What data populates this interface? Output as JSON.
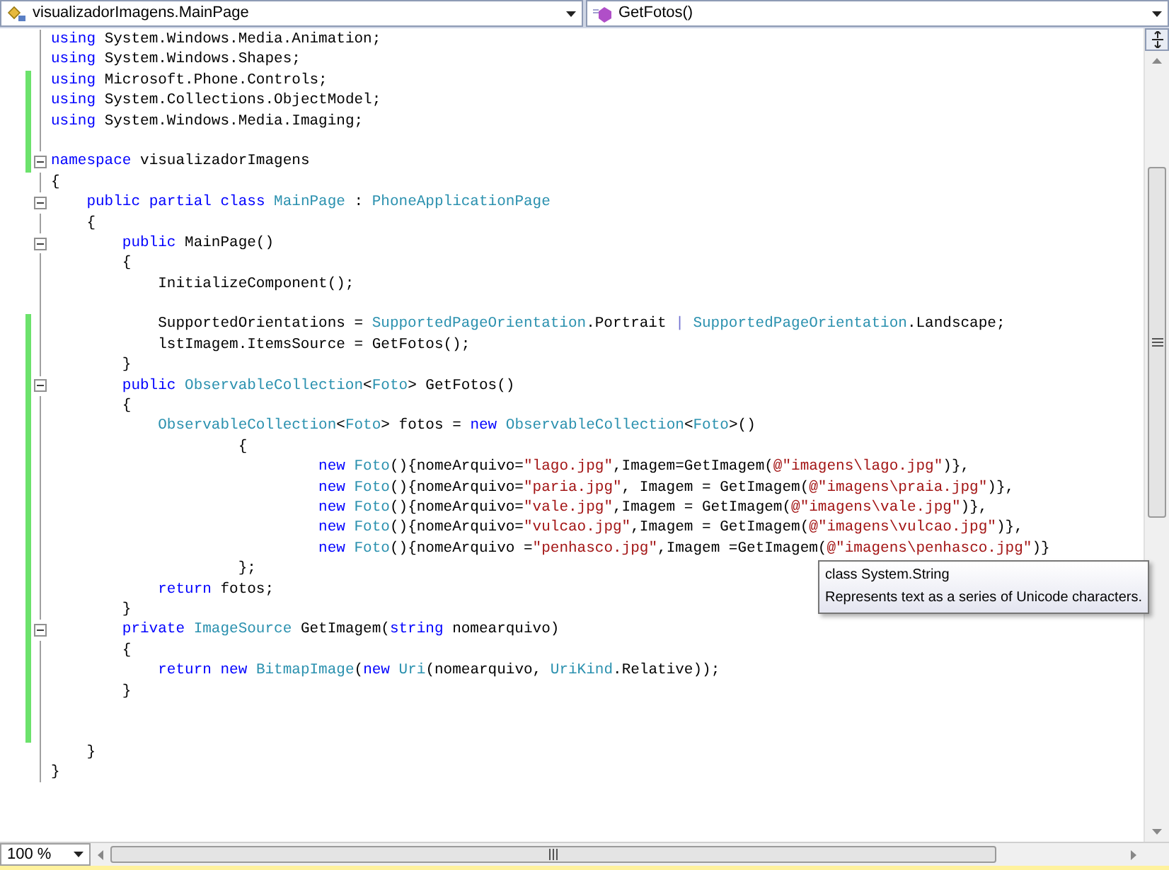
{
  "navigation": {
    "type_combo": "visualizadorImagens.MainPage",
    "member_combo": "GetFotos()"
  },
  "editor": {
    "lines": [
      {
        "changed": false,
        "collapsible": false,
        "segments": [
          {
            "text": "using",
            "kind": "keyword"
          },
          {
            "text": " System.Windows.Media.Animation;",
            "kind": "plain"
          }
        ]
      },
      {
        "changed": false,
        "collapsible": false,
        "segments": [
          {
            "text": "using",
            "kind": "keyword"
          },
          {
            "text": " System.Windows.Shapes;",
            "kind": "plain"
          }
        ]
      },
      {
        "changed": true,
        "collapsible": false,
        "segments": [
          {
            "text": "using",
            "kind": "keyword"
          },
          {
            "text": " Microsoft.Phone.Controls;",
            "kind": "plain"
          }
        ]
      },
      {
        "changed": true,
        "collapsible": false,
        "segments": [
          {
            "text": "using",
            "kind": "keyword"
          },
          {
            "text": " System.Collections.ObjectModel;",
            "kind": "plain"
          }
        ]
      },
      {
        "changed": true,
        "collapsible": false,
        "segments": [
          {
            "text": "using",
            "kind": "keyword"
          },
          {
            "text": " System.Windows.Media.Imaging;",
            "kind": "plain"
          }
        ]
      },
      {
        "changed": true,
        "collapsible": false
      },
      {
        "changed": true,
        "collapsible": true,
        "segments": [
          {
            "text": "namespace",
            "kind": "keyword"
          },
          {
            "text": " visualizadorImagens",
            "kind": "plain"
          }
        ]
      },
      {
        "changed": false,
        "collapsible": false,
        "segments": [
          {
            "text": "{",
            "kind": "plain"
          }
        ]
      },
      {
        "changed": false,
        "collapsible": true,
        "segments": [
          {
            "text": "    public ",
            "kind": "keyword"
          },
          {
            "text": "partial ",
            "kind": "keyword"
          },
          {
            "text": "class ",
            "kind": "keyword"
          },
          {
            "text": "MainPage",
            "kind": "type"
          },
          {
            "text": " : ",
            "kind": "plain"
          },
          {
            "text": "PhoneApplicationPage",
            "kind": "type"
          }
        ]
      },
      {
        "changed": false,
        "collapsible": false,
        "segments": [
          {
            "text": "    {",
            "kind": "plain"
          }
        ]
      },
      {
        "changed": false,
        "collapsible": true,
        "segments": [
          {
            "text": "        public",
            "kind": "keyword"
          },
          {
            "text": " MainPage()",
            "kind": "plain"
          }
        ]
      },
      {
        "changed": false,
        "collapsible": false,
        "segments": [
          {
            "text": "        {",
            "kind": "plain"
          }
        ]
      },
      {
        "changed": false,
        "collapsible": false,
        "segments": [
          {
            "text": "            InitializeComponent();",
            "kind": "plain"
          }
        ]
      },
      {
        "changed": false,
        "collapsible": false
      },
      {
        "changed": true,
        "collapsible": false,
        "segments": [
          {
            "text": "            SupportedOrientations = ",
            "kind": "plain"
          },
          {
            "text": "SupportedPageOrientation",
            "kind": "type"
          },
          {
            "text": ".Portrait ",
            "kind": "plain"
          },
          {
            "text": "| ",
            "kind": "operator"
          },
          {
            "text": "SupportedPageOrientation",
            "kind": "type"
          },
          {
            "text": ".Landscape;",
            "kind": "plain"
          }
        ]
      },
      {
        "changed": true,
        "collapsible": false,
        "segments": [
          {
            "text": "            lstImagem.ItemsSource = GetFotos();",
            "kind": "plain"
          }
        ]
      },
      {
        "changed": true,
        "collapsible": false,
        "segments": [
          {
            "text": "        }",
            "kind": "plain"
          }
        ]
      },
      {
        "changed": true,
        "collapsible": true,
        "segments": [
          {
            "text": "        public ",
            "kind": "keyword"
          },
          {
            "text": "ObservableCollection",
            "kind": "type"
          },
          {
            "text": "<",
            "kind": "plain"
          },
          {
            "text": "Foto",
            "kind": "type"
          },
          {
            "text": "> GetFotos()",
            "kind": "plain"
          }
        ]
      },
      {
        "changed": true,
        "collapsible": false,
        "segments": [
          {
            "text": "        {",
            "kind": "plain"
          }
        ]
      },
      {
        "changed": true,
        "collapsible": false,
        "segments": [
          {
            "text": "            ObservableCollection",
            "kind": "type"
          },
          {
            "text": "<",
            "kind": "plain"
          },
          {
            "text": "Foto",
            "kind": "type"
          },
          {
            "text": "> fotos = ",
            "kind": "plain"
          },
          {
            "text": "new ",
            "kind": "keyword"
          },
          {
            "text": "ObservableCollection",
            "kind": "type"
          },
          {
            "text": "<",
            "kind": "plain"
          },
          {
            "text": "Foto",
            "kind": "type"
          },
          {
            "text": ">()",
            "kind": "plain"
          }
        ]
      },
      {
        "changed": true,
        "collapsible": false,
        "segments": [
          {
            "text": "                     {",
            "kind": "plain"
          }
        ]
      },
      {
        "changed": true,
        "collapsible": false,
        "segments": [
          {
            "text": "                              new ",
            "kind": "keyword"
          },
          {
            "text": "Foto",
            "kind": "type"
          },
          {
            "text": "(){nomeArquivo=",
            "kind": "plain"
          },
          {
            "text": "\"lago.jpg\"",
            "kind": "string"
          },
          {
            "text": ",Imagem=GetImagem(",
            "kind": "plain"
          },
          {
            "text": "@\"imagens\\lago.jpg\"",
            "kind": "string"
          },
          {
            "text": ")},",
            "kind": "plain"
          }
        ]
      },
      {
        "changed": true,
        "collapsible": false,
        "segments": [
          {
            "text": "                              new ",
            "kind": "keyword"
          },
          {
            "text": "Foto",
            "kind": "type"
          },
          {
            "text": "(){nomeArquivo=",
            "kind": "plain"
          },
          {
            "text": "\"paria.jpg\"",
            "kind": "string"
          },
          {
            "text": ", Imagem = GetImagem(",
            "kind": "plain"
          },
          {
            "text": "@\"imagens\\praia.jpg\"",
            "kind": "string"
          },
          {
            "text": ")},",
            "kind": "plain"
          }
        ]
      },
      {
        "changed": true,
        "collapsible": false,
        "segments": [
          {
            "text": "                              new ",
            "kind": "keyword"
          },
          {
            "text": "Foto",
            "kind": "type"
          },
          {
            "text": "(){nomeArquivo=",
            "kind": "plain"
          },
          {
            "text": "\"vale.jpg\"",
            "kind": "string"
          },
          {
            "text": ",Imagem = GetImagem(",
            "kind": "plain"
          },
          {
            "text": "@\"imagens\\vale.jpg\"",
            "kind": "string"
          },
          {
            "text": ")},",
            "kind": "plain"
          }
        ]
      },
      {
        "changed": true,
        "collapsible": false,
        "segments": [
          {
            "text": "                              new ",
            "kind": "keyword"
          },
          {
            "text": "Foto",
            "kind": "type"
          },
          {
            "text": "(){nomeArquivo=",
            "kind": "plain"
          },
          {
            "text": "\"vulcao.jpg\"",
            "kind": "string"
          },
          {
            "text": ",Imagem = GetImagem(",
            "kind": "plain"
          },
          {
            "text": "@\"imagens\\vulcao.jpg\"",
            "kind": "string"
          },
          {
            "text": ")},",
            "kind": "plain"
          }
        ]
      },
      {
        "changed": true,
        "collapsible": false,
        "segments": [
          {
            "text": "                              new ",
            "kind": "keyword"
          },
          {
            "text": "Foto",
            "kind": "type"
          },
          {
            "text": "(){nomeArquivo =",
            "kind": "plain"
          },
          {
            "text": "\"penhasco.jpg\"",
            "kind": "string"
          },
          {
            "text": ",Imagem =GetImagem(",
            "kind": "plain"
          },
          {
            "text": "@\"imagens\\penhasco.jpg\"",
            "kind": "string"
          },
          {
            "text": ")}",
            "kind": "plain"
          }
        ]
      },
      {
        "changed": true,
        "collapsible": false,
        "segments": [
          {
            "text": "                     };",
            "kind": "plain"
          }
        ]
      },
      {
        "changed": true,
        "collapsible": false,
        "segments": [
          {
            "text": "            return",
            "kind": "keyword"
          },
          {
            "text": " fotos;",
            "kind": "plain"
          }
        ]
      },
      {
        "changed": true,
        "collapsible": false,
        "segments": [
          {
            "text": "        }",
            "kind": "plain"
          }
        ]
      },
      {
        "changed": true,
        "collapsible": true,
        "segments": [
          {
            "text": "        private ",
            "kind": "keyword"
          },
          {
            "text": "ImageSource",
            "kind": "type"
          },
          {
            "text": " GetImagem(",
            "kind": "plain"
          },
          {
            "text": "string",
            "kind": "keyword"
          },
          {
            "text": " nomearquivo)",
            "kind": "plain"
          }
        ]
      },
      {
        "changed": true,
        "collapsible": false,
        "segments": [
          {
            "text": "        {",
            "kind": "plain"
          }
        ]
      },
      {
        "changed": true,
        "collapsible": false,
        "segments": [
          {
            "text": "            return new ",
            "kind": "keyword"
          },
          {
            "text": "BitmapImage",
            "kind": "type"
          },
          {
            "text": "(",
            "kind": "plain"
          },
          {
            "text": "new ",
            "kind": "keyword"
          },
          {
            "text": "Uri",
            "kind": "type"
          },
          {
            "text": "(nomearquivo, ",
            "kind": "plain"
          },
          {
            "text": "UriKind",
            "kind": "type"
          },
          {
            "text": ".Relative));",
            "kind": "plain"
          }
        ]
      },
      {
        "changed": true,
        "collapsible": false,
        "segments": [
          {
            "text": "        }",
            "kind": "plain"
          }
        ]
      },
      {
        "changed": true,
        "collapsible": false
      },
      {
        "changed": true,
        "collapsible": false
      },
      {
        "changed": false,
        "collapsible": false,
        "segments": [
          {
            "text": "    }",
            "kind": "plain"
          }
        ]
      },
      {
        "changed": false,
        "collapsible": false,
        "segments": [
          {
            "text": "}",
            "kind": "plain"
          }
        ]
      }
    ]
  },
  "tooltip": {
    "title": "class System.String",
    "description": "Represents text as a series of Unicode characters."
  },
  "zoom": "100 %"
}
